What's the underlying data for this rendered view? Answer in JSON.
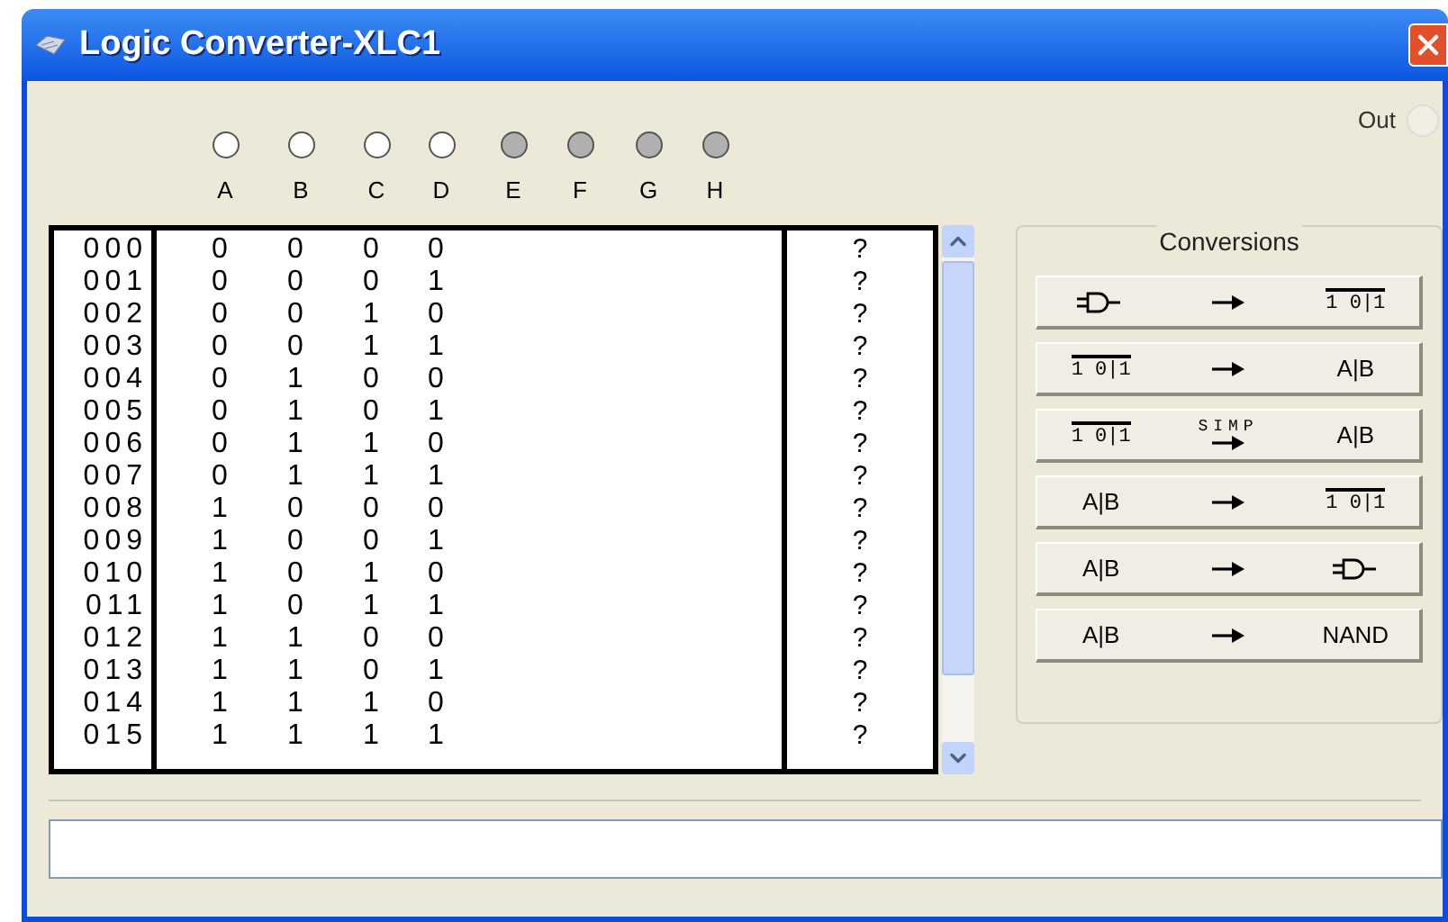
{
  "window": {
    "title": "Logic Converter-XLC1"
  },
  "inputs": [
    {
      "label": "A",
      "selected": true
    },
    {
      "label": "B",
      "selected": true
    },
    {
      "label": "C",
      "selected": true
    },
    {
      "label": "D",
      "selected": true
    },
    {
      "label": "E",
      "selected": false
    },
    {
      "label": "F",
      "selected": false
    },
    {
      "label": "G",
      "selected": false
    },
    {
      "label": "H",
      "selected": false
    }
  ],
  "out": {
    "label": "Out"
  },
  "table": {
    "rows": [
      {
        "index": "000",
        "values": [
          "0",
          "0",
          "0",
          "0"
        ],
        "output": "?"
      },
      {
        "index": "001",
        "values": [
          "0",
          "0",
          "0",
          "1"
        ],
        "output": "?"
      },
      {
        "index": "002",
        "values": [
          "0",
          "0",
          "1",
          "0"
        ],
        "output": "?"
      },
      {
        "index": "003",
        "values": [
          "0",
          "0",
          "1",
          "1"
        ],
        "output": "?"
      },
      {
        "index": "004",
        "values": [
          "0",
          "1",
          "0",
          "0"
        ],
        "output": "?"
      },
      {
        "index": "005",
        "values": [
          "0",
          "1",
          "0",
          "1"
        ],
        "output": "?"
      },
      {
        "index": "006",
        "values": [
          "0",
          "1",
          "1",
          "0"
        ],
        "output": "?"
      },
      {
        "index": "007",
        "values": [
          "0",
          "1",
          "1",
          "1"
        ],
        "output": "?"
      },
      {
        "index": "008",
        "values": [
          "1",
          "0",
          "0",
          "0"
        ],
        "output": "?"
      },
      {
        "index": "009",
        "values": [
          "1",
          "0",
          "0",
          "1"
        ],
        "output": "?"
      },
      {
        "index": "010",
        "values": [
          "1",
          "0",
          "1",
          "0"
        ],
        "output": "?"
      },
      {
        "index": "011",
        "values": [
          "1",
          "0",
          "1",
          "1"
        ],
        "output": "?"
      },
      {
        "index": "012",
        "values": [
          "1",
          "1",
          "0",
          "0"
        ],
        "output": "?"
      },
      {
        "index": "013",
        "values": [
          "1",
          "1",
          "0",
          "1"
        ],
        "output": "?"
      },
      {
        "index": "014",
        "values": [
          "1",
          "1",
          "1",
          "0"
        ],
        "output": "?"
      },
      {
        "index": "015",
        "values": [
          "1",
          "1",
          "1",
          "1"
        ],
        "output": "?"
      }
    ]
  },
  "conversions": {
    "title": "Conversions",
    "buttons": [
      {
        "from": {
          "kind": "gate"
        },
        "to": {
          "kind": "table",
          "text": "1 0|1"
        }
      },
      {
        "from": {
          "kind": "table",
          "text": "1 0|1"
        },
        "to": {
          "kind": "text",
          "text": "A|B"
        }
      },
      {
        "from": {
          "kind": "table",
          "text": "1 0|1"
        },
        "arrow_label": "SIMP",
        "to": {
          "kind": "text",
          "text": "A|B"
        }
      },
      {
        "from": {
          "kind": "text",
          "text": "A|B"
        },
        "to": {
          "kind": "table",
          "text": "1 0|1"
        }
      },
      {
        "from": {
          "kind": "text",
          "text": "A|B"
        },
        "to": {
          "kind": "gate"
        }
      },
      {
        "from": {
          "kind": "text",
          "text": "A|B"
        },
        "to": {
          "kind": "text",
          "text": "NAND"
        }
      }
    ]
  }
}
